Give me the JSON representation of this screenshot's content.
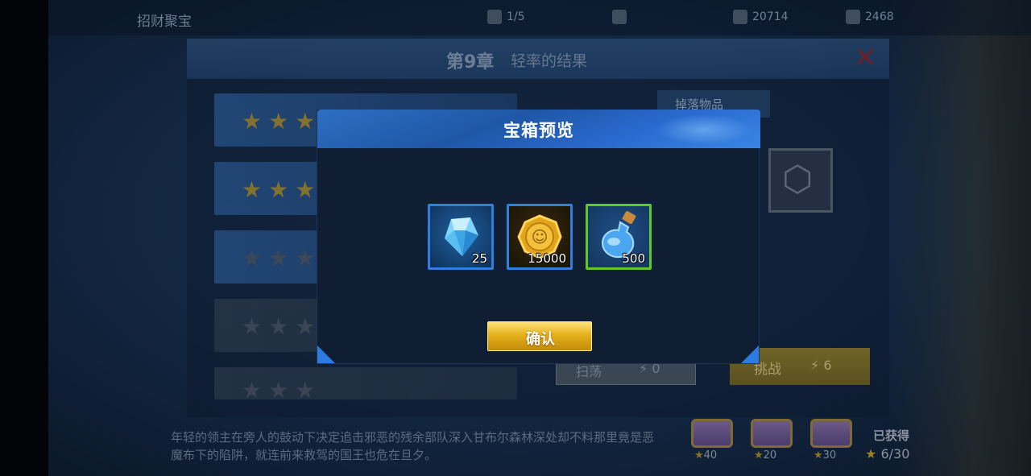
{
  "top_bar": {
    "title": "招财聚宝",
    "resources": [
      "1/5",
      "",
      "20714",
      "2468"
    ]
  },
  "chapter": {
    "number": "第9章",
    "name": "轻率的结果"
  },
  "stage_rows": [
    {
      "stars": "★★★"
    },
    {
      "stars": "★★★"
    },
    {
      "stars": "★★★"
    },
    {
      "stars": "★★★"
    },
    {
      "stars": "★★★"
    }
  ],
  "right_panel": {
    "drop_tag": "掉落物品",
    "sweep_label": "扫荡",
    "sweep_cost": "0",
    "battle_label": "挑战",
    "battle_cost": "6"
  },
  "story_text": "年轻的领主在旁人的鼓动下决定追击邪恶的残余部队深入甘布尔森林深处却不料那里竟是恶魔布下的陷阱，就连前来救驾的国王也危在旦夕。",
  "star_chests": [
    {
      "required_stars": "40"
    },
    {
      "required_stars": "20"
    },
    {
      "required_stars": "30"
    }
  ],
  "obtained": {
    "label": "已获得",
    "value": "6/30"
  },
  "modal": {
    "title": "宝箱预览",
    "items": [
      {
        "icon": "blue-diamond-icon",
        "quantity": "25",
        "frame_color": "#2f7fdc"
      },
      {
        "icon": "gold-coin-icon",
        "quantity": "15000",
        "frame_color": "#2f7fdc"
      },
      {
        "icon": "blue-potion-icon",
        "quantity": "500",
        "frame_color": "#5fc82f"
      }
    ],
    "confirm_label": "确认"
  },
  "colors": {
    "modal_header": "#2d6fc2",
    "confirm_gold": "#e5b11c",
    "close_red": "#b2211d"
  }
}
